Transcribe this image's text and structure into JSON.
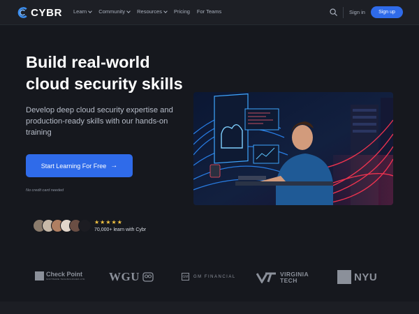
{
  "header": {
    "brand": "CYBR",
    "nav": [
      {
        "label": "Learn",
        "dropdown": true
      },
      {
        "label": "Community",
        "dropdown": true
      },
      {
        "label": "Resources",
        "dropdown": true
      },
      {
        "label": "Pricing",
        "dropdown": false
      },
      {
        "label": "For Teams",
        "dropdown": false
      }
    ],
    "search_icon": "search-icon",
    "signin_label": "Sign in",
    "signup_label": "Sign up"
  },
  "hero": {
    "title": "Build real-world cloud security skills",
    "subtitle": "Develop deep cloud security expertise and production-ready skills with our hands-on training",
    "cta_label": "Start Learning For Free",
    "cta_icon": "arrow-right-icon",
    "note": "No credit card needed"
  },
  "social_proof": {
    "rating_stars": 5,
    "stars": "★★★★★",
    "text": "70,000+ learn with Cybr"
  },
  "partners": {
    "checkpoint": {
      "name": "Check Point",
      "sub": "SOFTWARE TECHNOLOGIES LTD."
    },
    "wgu": {
      "name": "WGU"
    },
    "gm": {
      "name": "GM FINANCIAL",
      "mark": "GM"
    },
    "vt": {
      "line1": "VIRGINIA",
      "line2": "TECH"
    },
    "nyu": {
      "name": "NYU"
    }
  },
  "colors": {
    "background": "#16181e",
    "header": "#1d1f25",
    "accent": "#2f6bea",
    "star": "#f5c542",
    "muted_logo": "#8b909a"
  }
}
